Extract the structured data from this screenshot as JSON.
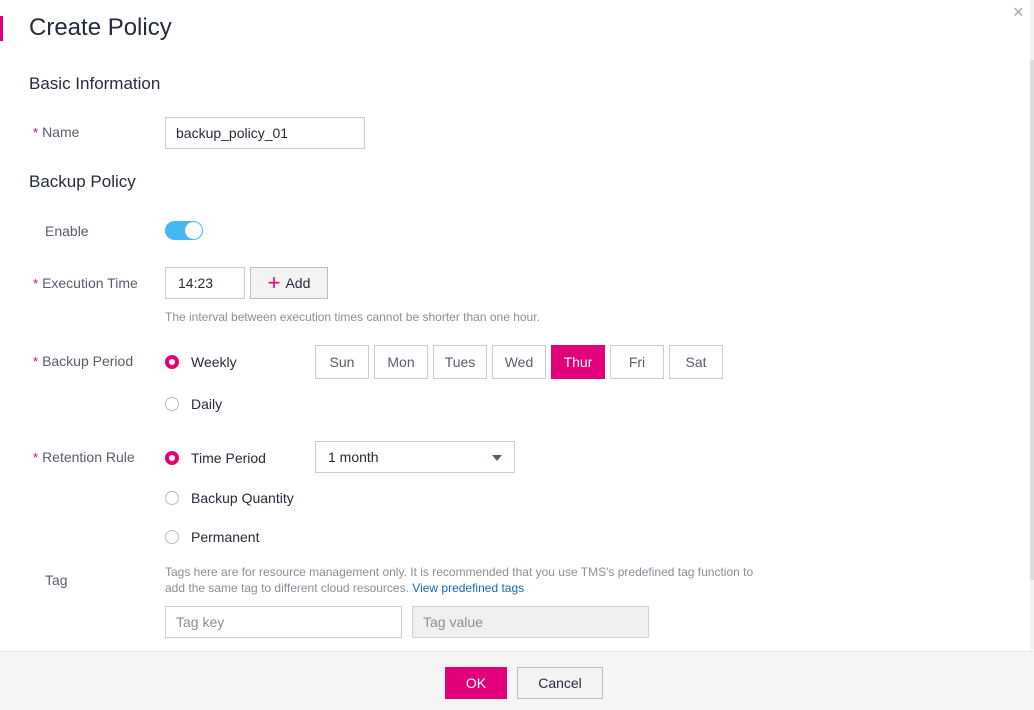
{
  "dialog": {
    "title": "Create Policy",
    "close_glyph": "×",
    "accent_color": "#e2007b"
  },
  "basic": {
    "section_title": "Basic Information",
    "name_label": "Name",
    "name_value": "backup_policy_01",
    "required_mark": "*"
  },
  "backup": {
    "section_title": "Backup Policy",
    "enable_label": "Enable",
    "enabled": true,
    "execution_label": "Execution Time",
    "execution_value": "14:23",
    "add_button": "Add",
    "interval_hint": "The interval between execution times cannot be shorter than one hour.",
    "period_label": "Backup Period",
    "weekly_label": "Weekly",
    "daily_label": "Daily",
    "days": [
      "Sun",
      "Mon",
      "Tues",
      "Wed",
      "Thur",
      "Fri",
      "Sat"
    ],
    "selected_day": "Thur"
  },
  "retention": {
    "label": "Retention Rule",
    "time_period_label": "Time Period",
    "time_period_value": "1 month",
    "quantity_label": "Backup Quantity",
    "permanent_label": "Permanent"
  },
  "tag": {
    "label": "Tag",
    "hint_line1": "Tags here are for resource management only. It is recommended that you use TMS's predefined tag function to",
    "hint_line2": "add the same tag to different cloud resources.",
    "link": "View predefined tags",
    "key_placeholder": "Tag key",
    "value_placeholder": "Tag value"
  },
  "footer": {
    "ok": "OK",
    "cancel": "Cancel"
  }
}
